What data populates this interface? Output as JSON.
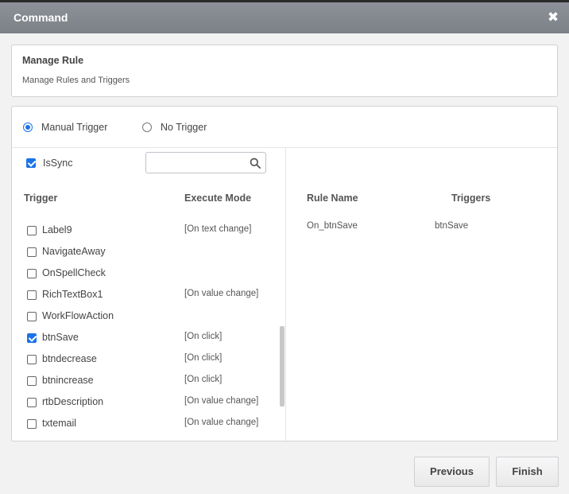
{
  "dialog": {
    "title": "Command",
    "close_icon": "close-icon"
  },
  "manage": {
    "heading": "Manage Rule",
    "subheading": "Manage Rules and Triggers"
  },
  "radios": [
    {
      "label": "Manual Trigger",
      "selected": true
    },
    {
      "label": "No Trigger",
      "selected": false
    }
  ],
  "left": {
    "issync_label": "IsSync",
    "issync_checked": true,
    "search_value": "",
    "search_icon": "search-icon",
    "headers": {
      "trigger": "Trigger",
      "mode": "Execute Mode"
    },
    "rows": [
      {
        "name": "Label9",
        "mode": "[On text change]",
        "checked": false
      },
      {
        "name": "NavigateAway",
        "mode": "",
        "checked": false
      },
      {
        "name": "OnSpellCheck",
        "mode": "",
        "checked": false
      },
      {
        "name": "RichTextBox1",
        "mode": "[On value change]",
        "checked": false
      },
      {
        "name": "WorkFlowAction",
        "mode": "",
        "checked": false
      },
      {
        "name": "btnSave",
        "mode": "[On click]",
        "checked": true
      },
      {
        "name": "btndecrease",
        "mode": "[On click]",
        "checked": false
      },
      {
        "name": "btnincrease",
        "mode": "[On click]",
        "checked": false
      },
      {
        "name": "rtbDescription",
        "mode": "[On value change]",
        "checked": false
      },
      {
        "name": "txtemail",
        "mode": "[On value change]",
        "checked": false
      },
      {
        "name": "",
        "mode": "",
        "checked": false
      }
    ]
  },
  "right": {
    "headers": {
      "rule_name": "Rule Name",
      "triggers": "Triggers"
    },
    "rules": [
      {
        "rule_name": "On_btnSave",
        "triggers": "btnSave"
      }
    ]
  },
  "footer": {
    "previous_label": "Previous",
    "finish_label": "Finish"
  }
}
